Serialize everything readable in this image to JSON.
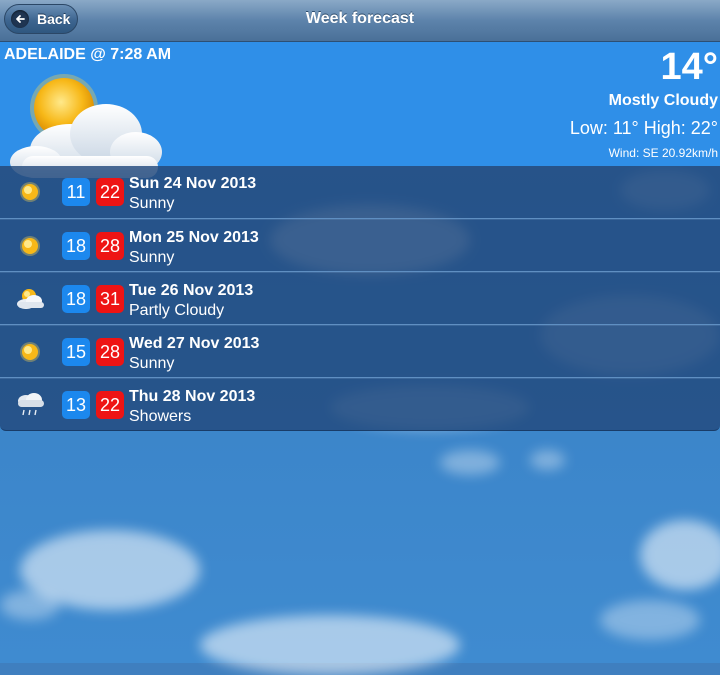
{
  "header": {
    "back_label": "Back",
    "title": "Week forecast"
  },
  "current": {
    "location": "ADELAIDE @ 7:28 AM",
    "temperature": "14°",
    "conditions": "Mostly Cloudy",
    "low_high": "Low: 11° High: 22°",
    "wind": "Wind: SE 20.92km/h",
    "icon": "mostly-cloudy-icon"
  },
  "forecast": [
    {
      "low": "11",
      "high": "22",
      "date": "Sun 24 Nov 2013",
      "desc": "Sunny",
      "icon": "sunny-icon"
    },
    {
      "low": "18",
      "high": "28",
      "date": "Mon 25 Nov 2013",
      "desc": "Sunny",
      "icon": "sunny-icon"
    },
    {
      "low": "18",
      "high": "31",
      "date": "Tue 26 Nov 2013",
      "desc": "Partly Cloudy",
      "icon": "partly-cloudy-icon"
    },
    {
      "low": "15",
      "high": "28",
      "date": "Wed 27 Nov 2013",
      "desc": "Sunny",
      "icon": "sunny-icon"
    },
    {
      "low": "13",
      "high": "22",
      "date": "Thu 28 Nov 2013",
      "desc": "Showers",
      "icon": "showers-icon"
    }
  ],
  "colors": {
    "low_badge": "#1c88ee",
    "high_badge": "#ee1414",
    "current_panel": "#2f8fe8"
  }
}
